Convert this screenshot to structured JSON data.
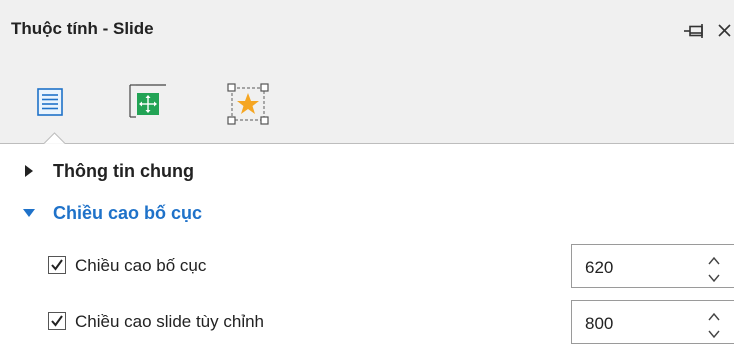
{
  "panel": {
    "title": "Thuộc tính - Slide",
    "pin_icon": "pin-icon",
    "close_icon": "close-icon",
    "tabs": [
      {
        "icon": "properties-list-icon"
      },
      {
        "icon": "layout-resize-icon"
      },
      {
        "icon": "effects-star-icon"
      }
    ]
  },
  "sections": {
    "general": {
      "label": "Thông tin chung",
      "expanded": false
    },
    "layout_height": {
      "label": "Chiều cao bố cục",
      "expanded": true,
      "rows": [
        {
          "label": "Chiều cao bố cục",
          "checked": true,
          "value": "620"
        },
        {
          "label": "Chiều cao slide tùy chỉnh",
          "checked": true,
          "value": "800"
        }
      ]
    }
  },
  "colors": {
    "accent": "#1f72c9",
    "titlebar_bg": "#f0f0f0"
  }
}
